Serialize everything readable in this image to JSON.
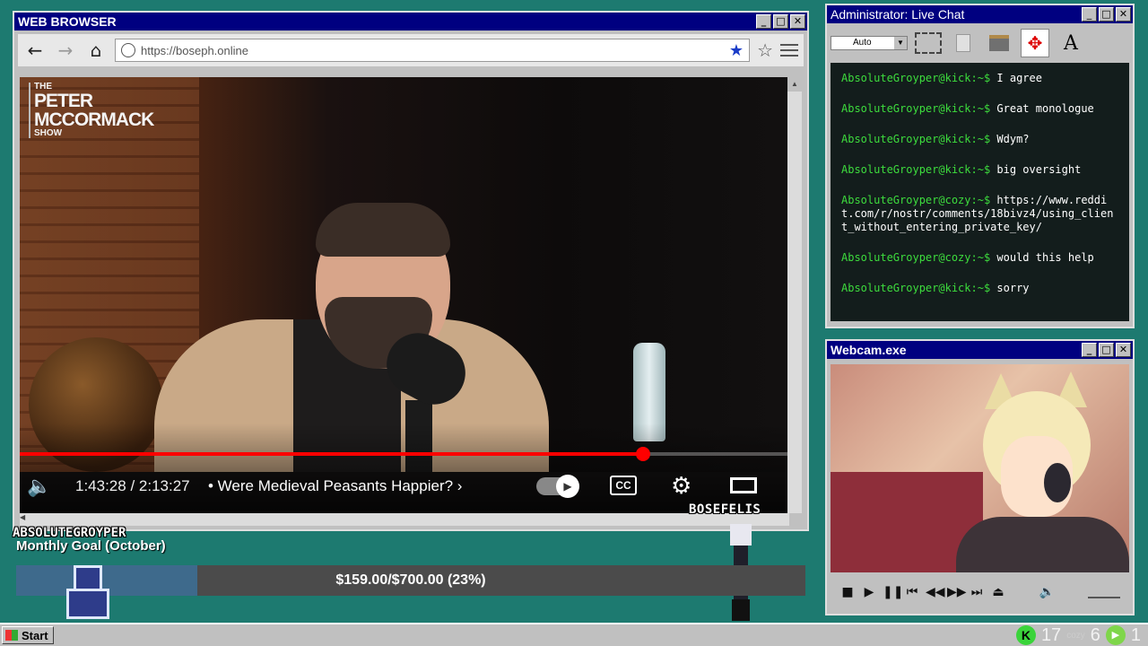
{
  "browser": {
    "title": "WEB BROWSER",
    "window_controls": [
      "_",
      "□",
      "✕"
    ],
    "url": "https://boseph.online"
  },
  "video": {
    "logo": {
      "line1": "THE",
      "line2a": "PETER",
      "line2b": "MCCORMACK",
      "line3": "SHOW"
    },
    "time": "1:43:28 / 2:13:27",
    "chapter_title": "• Were Medieval Peasants Happier?",
    "chapter_arrow": "›",
    "progress_fraction": 0.81,
    "cc_label": "CC"
  },
  "chat": {
    "title": "Administrator: Live Chat",
    "zoom_value": "Auto",
    "messages": [
      {
        "user": "AbsoluteGroyper@kick:~$",
        "text": " I agree"
      },
      {
        "user": "AbsoluteGroyper@kick:~$",
        "text": " Great monologue"
      },
      {
        "user": "AbsoluteGroyper@kick:~$",
        "text": " Wdym?"
      },
      {
        "user": "AbsoluteGroyper@kick:~$",
        "text": " big oversight"
      },
      {
        "user": "AbsoluteGroyper@cozy:~$",
        "text": " https://www.reddit.com/r/nostr/comments/18bivz4/using_client_without_entering_private_key/"
      },
      {
        "user": "AbsoluteGroyper@cozy:~$",
        "text": " would this help"
      },
      {
        "user": "AbsoluteGroyper@kick:~$",
        "text": " sorry"
      }
    ]
  },
  "webcam": {
    "title": "Webcam.exe"
  },
  "overlay": {
    "streamer": "BOSEFELIS",
    "goal_user": "ABSOLUTEGROYPER",
    "goal_title": "Monthly Goal (October)",
    "goal_label": "$159.00/$700.00 (23%)",
    "goal_fraction": 0.23
  },
  "taskbar": {
    "start_label": "Start",
    "kick_icon": "K",
    "kick_count": "17",
    "cozy_count": "6",
    "play_count": "1"
  }
}
